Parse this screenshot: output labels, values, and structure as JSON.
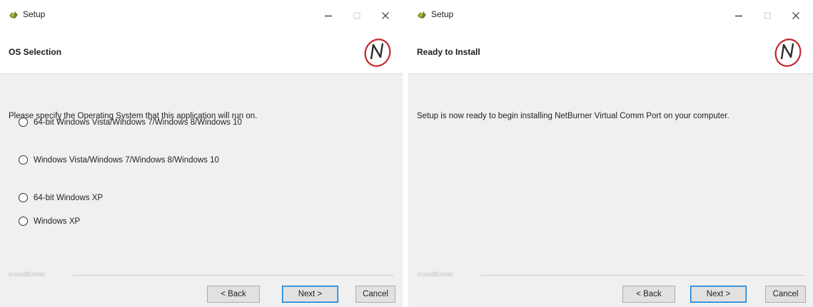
{
  "left_window": {
    "title": "Setup",
    "header_title": "OS Selection",
    "instruction": "Please specify the Operating System that this application will run on.",
    "options": [
      {
        "label": "64-bit Windows Vista/Windows 7/Windows 8/Windows 10",
        "selected": false
      },
      {
        "label": "Windows Vista/Windows 7/Windows 8/Windows 10",
        "selected": false
      },
      {
        "label": "64-bit Windows XP",
        "selected": false
      },
      {
        "label": "Windows XP",
        "selected": false
      }
    ],
    "brand": "InstallBuilder",
    "buttons": {
      "back": "< Back",
      "next": "Next >",
      "cancel": "Cancel"
    }
  },
  "right_window": {
    "title": "Setup",
    "header_title": "Ready to Install",
    "message": "Setup is now ready to begin installing NetBurner Virtual Comm Port on your computer.",
    "brand": "InstallBuilder",
    "buttons": {
      "back": "< Back",
      "next": "Next >",
      "cancel": "Cancel"
    }
  },
  "icons": {
    "app": "app-icon",
    "minimize": "minimize-icon",
    "maximize": "maximize-icon",
    "close": "close-icon",
    "logo": "netburner-logo"
  },
  "colors": {
    "accent": "#0078d7",
    "logo_red": "#c0282d",
    "window_bg": "#f0f0f0"
  }
}
